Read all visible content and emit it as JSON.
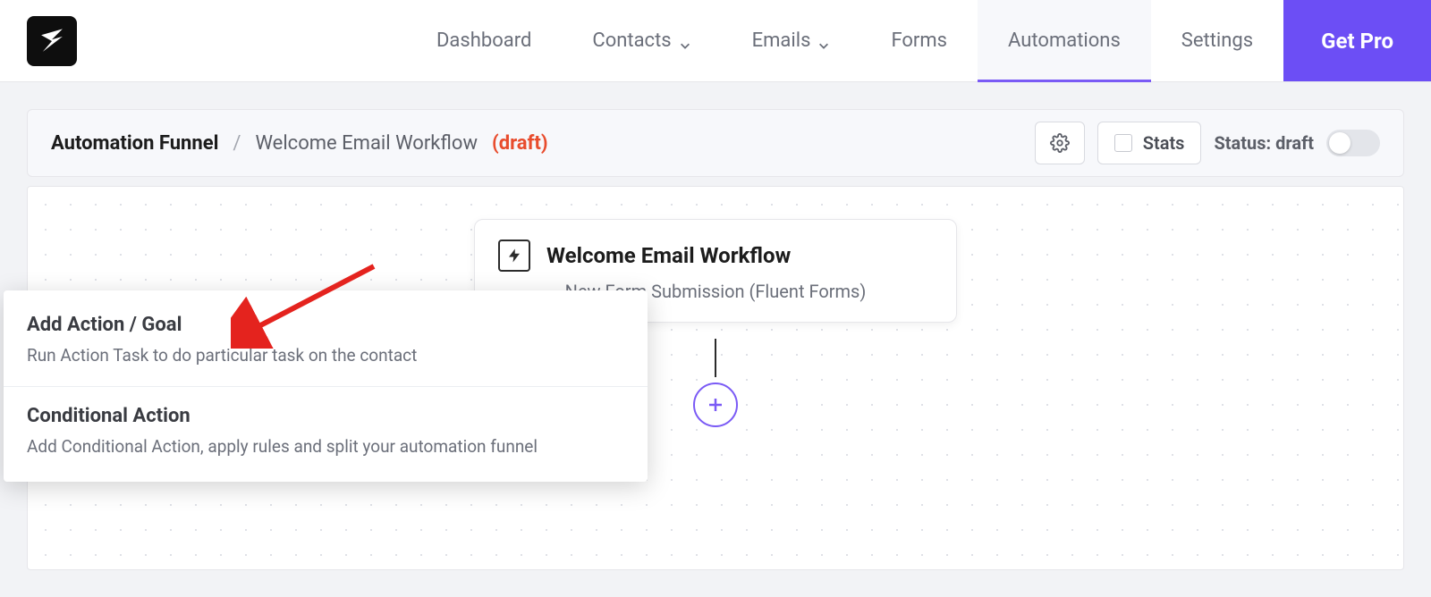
{
  "nav": {
    "items": [
      {
        "label": "Dashboard",
        "has_chevron": false
      },
      {
        "label": "Contacts",
        "has_chevron": true
      },
      {
        "label": "Emails",
        "has_chevron": true
      },
      {
        "label": "Forms",
        "has_chevron": false
      },
      {
        "label": "Automations",
        "has_chevron": false,
        "active": true
      },
      {
        "label": "Settings",
        "has_chevron": false
      }
    ],
    "cta": "Get Pro"
  },
  "subheader": {
    "root": "Automation Funnel",
    "separator": "/",
    "current": "Welcome Email Workflow",
    "draft_tag": "(draft)",
    "stats_label": "Stats",
    "status_label": "Status: draft"
  },
  "canvas": {
    "trigger": {
      "title": "Welcome Email Workflow",
      "subtitle": "New Form Submission (Fluent Forms)"
    }
  },
  "popover": {
    "items": [
      {
        "title": "Add Action / Goal",
        "desc": "Run Action Task to do particular task on the contact"
      },
      {
        "title": "Conditional Action",
        "desc": "Add Conditional Action, apply rules and split your automation funnel"
      }
    ]
  }
}
